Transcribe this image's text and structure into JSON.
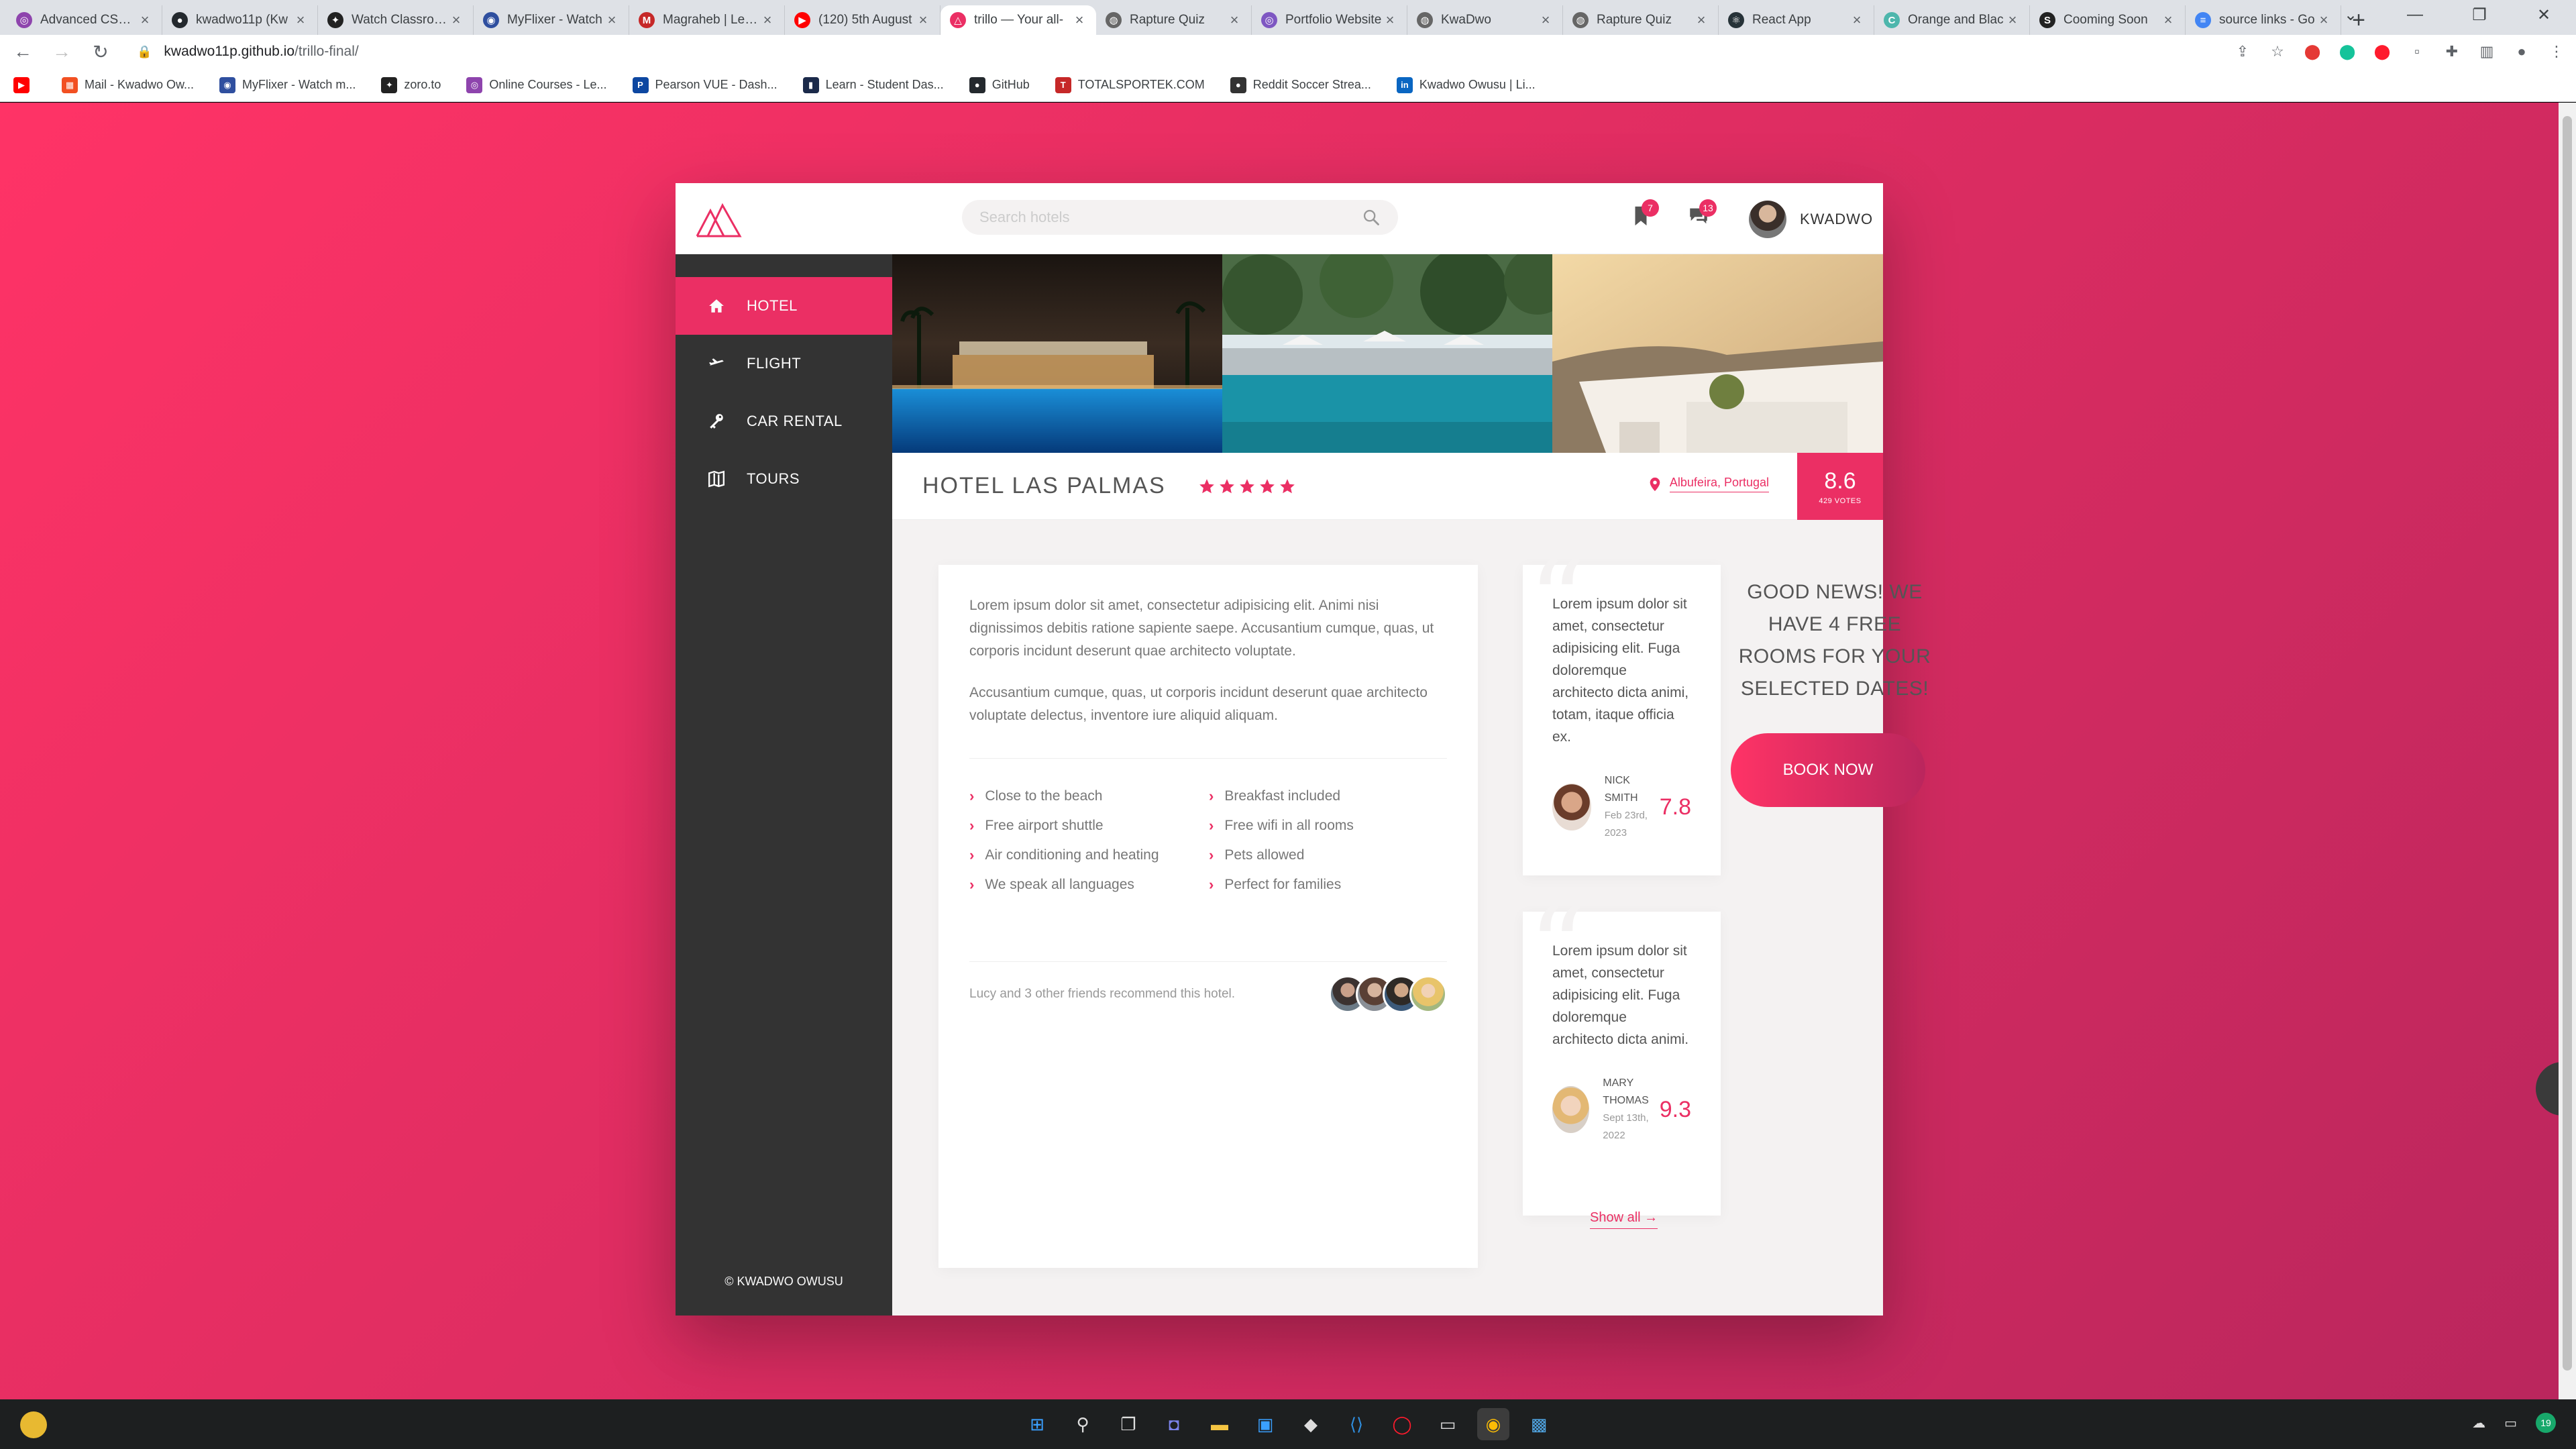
{
  "browser": {
    "tabs": [
      {
        "title": "Advanced CSS an",
        "color": "#8e44ad",
        "glyph": "◎"
      },
      {
        "title": "kwadwo11p (Kw",
        "color": "#24292e",
        "glyph": "●"
      },
      {
        "title": "Watch Classroom",
        "color": "#222",
        "glyph": "✦"
      },
      {
        "title": "MyFlixer - Watch",
        "color": "#2f4f9f",
        "glyph": "◉"
      },
      {
        "title": "Magraheb | Let m",
        "color": "#c62828",
        "glyph": "M"
      },
      {
        "title": "(120) 5th August",
        "color": "#ff0000",
        "glyph": "▶"
      },
      {
        "title": "trillo — Your all-",
        "color": "#eb2f64",
        "glyph": "△",
        "active": true
      },
      {
        "title": "Rapture Quiz",
        "color": "#666",
        "glyph": "◍"
      },
      {
        "title": "Portfolio Website",
        "color": "#7e57c2",
        "glyph": "◎"
      },
      {
        "title": "KwaDwo",
        "color": "#666",
        "glyph": "◍"
      },
      {
        "title": "Rapture Quiz",
        "color": "#666",
        "glyph": "◍"
      },
      {
        "title": "React App",
        "color": "#263238",
        "glyph": "⚛"
      },
      {
        "title": "Orange and Blac",
        "color": "#4db6ac",
        "glyph": "C"
      },
      {
        "title": "Cooming Soon",
        "color": "#222",
        "glyph": "S"
      },
      {
        "title": "source links - Go",
        "color": "#4285f4",
        "glyph": "≡"
      }
    ],
    "url_host": "kwadwo11p.github.io",
    "url_path": "/trillo-final/",
    "bookmarks": [
      {
        "label": "",
        "color": "#ff0000",
        "glyph": "▶"
      },
      {
        "label": "Mail - Kwadwo Ow...",
        "color": "#f25022",
        "glyph": "▦"
      },
      {
        "label": "MyFlixer - Watch m...",
        "color": "#2f4f9f",
        "glyph": "◉"
      },
      {
        "label": "zoro.to",
        "color": "#222",
        "glyph": "✦"
      },
      {
        "label": "Online Courses - Le...",
        "color": "#8e44ad",
        "glyph": "◎"
      },
      {
        "label": "Pearson VUE - Dash...",
        "color": "#0d47a1",
        "glyph": "P"
      },
      {
        "label": "Learn - Student Das...",
        "color": "#1b2a4a",
        "glyph": "▮"
      },
      {
        "label": "GitHub",
        "color": "#24292e",
        "glyph": "●"
      },
      {
        "label": "TOTALSPORTEK.COM",
        "color": "#c62828",
        "glyph": "T"
      },
      {
        "label": "Reddit Soccer Strea...",
        "color": "#333",
        "glyph": "●"
      },
      {
        "label": "Kwadwo Owusu | Li...",
        "color": "#0a66c2",
        "glyph": "in"
      }
    ]
  },
  "header": {
    "search_placeholder": "Search hotels",
    "bookmarks_count": "7",
    "chat_count": "13",
    "user_name": "KWADWO"
  },
  "sidebar": {
    "items": [
      {
        "label": "Hotel",
        "icon": "home-icon",
        "active": true
      },
      {
        "label": "Flight",
        "icon": "aircraft-icon"
      },
      {
        "label": "Car rental",
        "icon": "key-icon"
      },
      {
        "label": "Tours",
        "icon": "map-icon"
      }
    ],
    "copyright": "© KWADWO OWUSU"
  },
  "overview": {
    "hotel_name": "Hotel Las Palmas",
    "stars": 5,
    "location": "Albufeira, Portugal",
    "rating_average": "8.6",
    "rating_count": "429 VOTES"
  },
  "description": {
    "paragraph_1": "Lorem ipsum dolor sit amet, consectetur adipisicing elit. Animi nisi dignissimos debitis ratione sapiente saepe. Accusantium cumque, quas, ut corporis incidunt deserunt quae architecto voluptate.",
    "paragraph_2": "Accusantium cumque, quas, ut corporis incidunt deserunt quae architecto voluptate delectus, inventore iure aliquid aliquam.",
    "features": [
      "Close to the beach",
      "Breakfast included",
      "Free airport shuttle",
      "Free wifi in all rooms",
      "Air conditioning and heating",
      "Pets allowed",
      "We speak all languages",
      "Perfect for families"
    ],
    "recommend_text": "Lucy and 3 other friends recommend this hotel."
  },
  "reviews": [
    {
      "text": "Lorem ipsum dolor sit amet, consectetur adipisicing elit. Fuga doloremque architecto dicta animi, totam, itaque officia ex.",
      "name": "Nick Smith",
      "date": "Feb 23rd, 2023",
      "rating": "7.8"
    },
    {
      "text": "Lorem ipsum dolor sit amet, consectetur adipisicing elit. Fuga doloremque architecto dicta animi.",
      "name": "Mary Thomas",
      "date": "Sept 13th, 2022",
      "rating": "9.3"
    }
  ],
  "show_all_label": "Show all →",
  "cta": {
    "text": "Good news! We have 4 free rooms for your selected dates!",
    "button_label": "Book now"
  },
  "colors": {
    "primary": "#eb2f64",
    "sidebar": "#333333",
    "background_gradient_start": "#ff3366",
    "background_gradient_end": "#ba265d"
  }
}
